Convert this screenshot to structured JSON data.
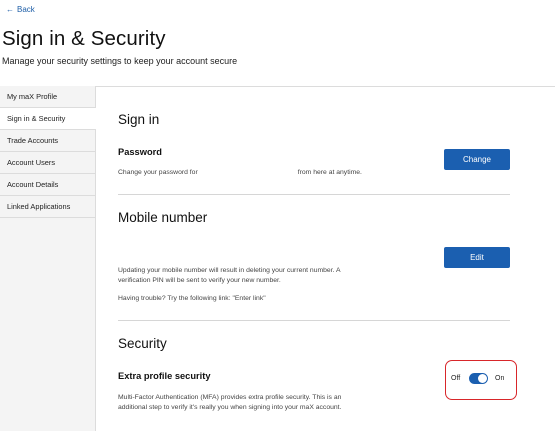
{
  "header": {
    "back_label": "Back",
    "title": "Sign in & Security",
    "subtitle": "Manage your security settings to keep your account secure"
  },
  "sidebar": {
    "items": [
      {
        "label": "My maX Profile"
      },
      {
        "label": "Sign in & Security"
      },
      {
        "label": "Trade Accounts"
      },
      {
        "label": "Account Users"
      },
      {
        "label": "Account Details"
      },
      {
        "label": "Linked Applications"
      }
    ],
    "active_index": 1
  },
  "signin": {
    "title": "Sign in",
    "password_label": "Password",
    "password_desc_prefix": "Change your password for",
    "password_desc_suffix": "from here at anytime.",
    "change_button": "Change"
  },
  "mobile": {
    "title": "Mobile number",
    "edit_button": "Edit",
    "desc_line1": "Updating your mobile number will result in deleting your current number. A",
    "desc_line2": "verification PIN will be sent to verify your new number.",
    "help_text": "Having trouble? Try the following link: \"Enter link\""
  },
  "security": {
    "title": "Security",
    "extra_label": "Extra profile security",
    "desc_line1": "Multi-Factor Authentication (MFA) provides extra profile security. This is an",
    "desc_line2": "additional step to verify it's really you when signing into your maX account.",
    "toggle_off": "Off",
    "toggle_on": "On",
    "toggle_state": "on"
  },
  "colors": {
    "accent": "#1b5fb0",
    "highlight": "#d8262a",
    "sidebar_bg": "#f4f4f4"
  }
}
